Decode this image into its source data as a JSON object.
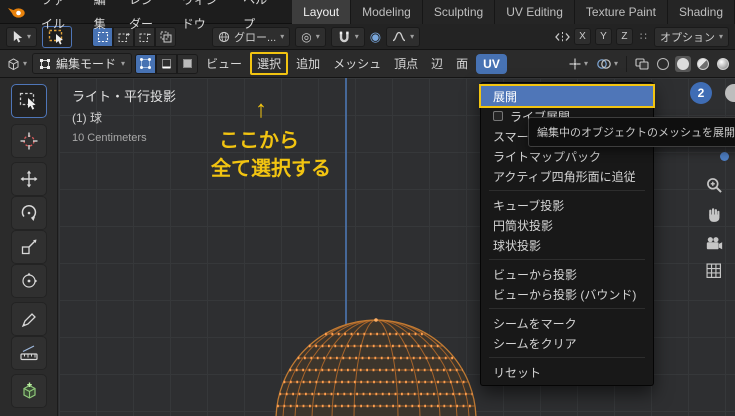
{
  "topbar": {
    "menus": [
      "ファイル",
      "編集",
      "レンダー",
      "ウィンドウ",
      "ヘルプ"
    ],
    "tabs": [
      {
        "label": "Layout",
        "active": true
      },
      {
        "label": "Modeling",
        "active": false
      },
      {
        "label": "Sculpting",
        "active": false
      },
      {
        "label": "UV Editing",
        "active": false
      },
      {
        "label": "Texture Paint",
        "active": false
      },
      {
        "label": "Shading",
        "active": false
      }
    ]
  },
  "transform_bar": {
    "orientation_label": "グロー...",
    "axis_x": "X",
    "axis_y": "Y",
    "axis_z": "Z",
    "options_label": "オプション"
  },
  "view_bar": {
    "mode_label": "編集モード",
    "menu_view": "ビュー",
    "menu_select": "選択",
    "menu_add": "追加",
    "menu_mesh": "メッシュ",
    "menu_vertex": "頂点",
    "menu_edge": "辺",
    "menu_face": "面",
    "menu_uv": "UV"
  },
  "viewport": {
    "view_label": "ライト・平行投影",
    "object_label": "(1) 球",
    "scale_label": "10 Centimeters",
    "gizmo_badge": "2"
  },
  "annotation": {
    "arrow": "↑",
    "line1": "ここから",
    "line2": "全て選択する",
    "color": "#f2c411"
  },
  "uv_menu": {
    "items": [
      {
        "label": "展開",
        "highlighted": true
      },
      {
        "label": "ライブ展開",
        "checkbox": true
      },
      {
        "label": "スマートUV投影"
      },
      {
        "label": "ライトマップパック"
      },
      {
        "label": "アクティブ四角形面に追従"
      },
      {
        "label": "キューブ投影"
      },
      {
        "label": "円筒状投影"
      },
      {
        "label": "球状投影"
      },
      {
        "label": "ビューから投影"
      },
      {
        "label": "ビューから投影 (バウンド)"
      },
      {
        "label": "シームをマーク"
      },
      {
        "label": "シームをクリア"
      },
      {
        "label": "リセット"
      }
    ]
  },
  "tooltip": {
    "text": "編集中のオブジェクトのメッシュを展開"
  },
  "colors": {
    "accent_blue": "#4772b3",
    "highlight_yellow": "#f2c411",
    "mesh_orange": "#ff9e4d"
  }
}
